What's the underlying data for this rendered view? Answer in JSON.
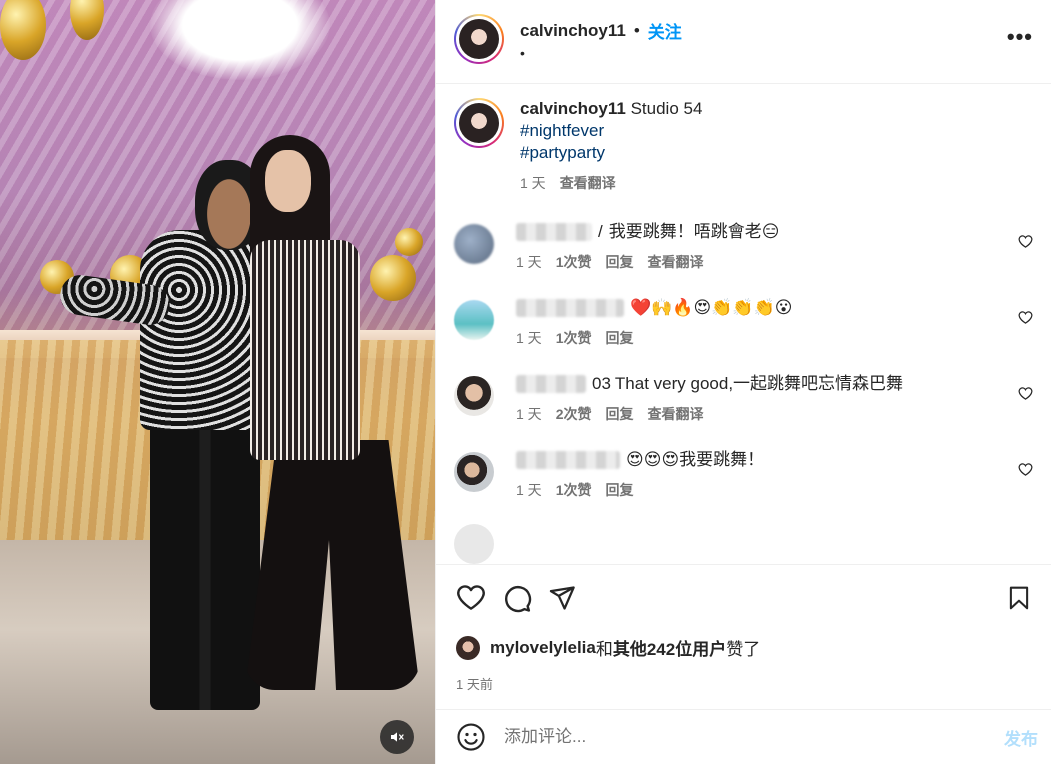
{
  "header": {
    "username": "calvinchoy11",
    "separator": "•",
    "follow_label": "关注",
    "subtitle": "•",
    "more": "•••"
  },
  "caption": {
    "username": "calvinchoy11",
    "text": "Studio 54",
    "tags": [
      "#nightfever",
      "#partyparty"
    ],
    "time": "1 天",
    "translate": "查看翻译"
  },
  "comments": [
    {
      "name_visible": "/",
      "text": "我要跳舞！唔跳會老",
      "emoji": "😑",
      "time": "1 天",
      "likes": "1次赞",
      "reply": "回复",
      "translate": "查看翻译"
    },
    {
      "name_visible": "",
      "text": "",
      "emoji": "❤️🙌🔥😍👏👏👏😮",
      "time": "1 天",
      "likes": "1次赞",
      "reply": "回复",
      "translate": ""
    },
    {
      "name_visible": "03",
      "text": "That very good,一起跳舞吧忘情森巴舞",
      "emoji": "",
      "time": "1 天",
      "likes": "2次赞",
      "reply": "回复",
      "translate": "查看翻译"
    },
    {
      "name_visible": "",
      "text": "我要跳舞！",
      "emoji": "😍😍😍",
      "time": "1 天",
      "likes": "1次赞",
      "reply": "回复",
      "translate": ""
    }
  ],
  "likes": {
    "user": "mylovelylelia",
    "joiner": "和",
    "others": "其他242位用户",
    "suffix": "赞了"
  },
  "post_time": "1 天前",
  "add_comment": {
    "placeholder": "添加评论...",
    "post_label": "发布"
  },
  "colors": {
    "accent": "#0095f6",
    "hashtag": "#00376b",
    "muted": "#737373",
    "post_disabled": "#b2dffc"
  }
}
